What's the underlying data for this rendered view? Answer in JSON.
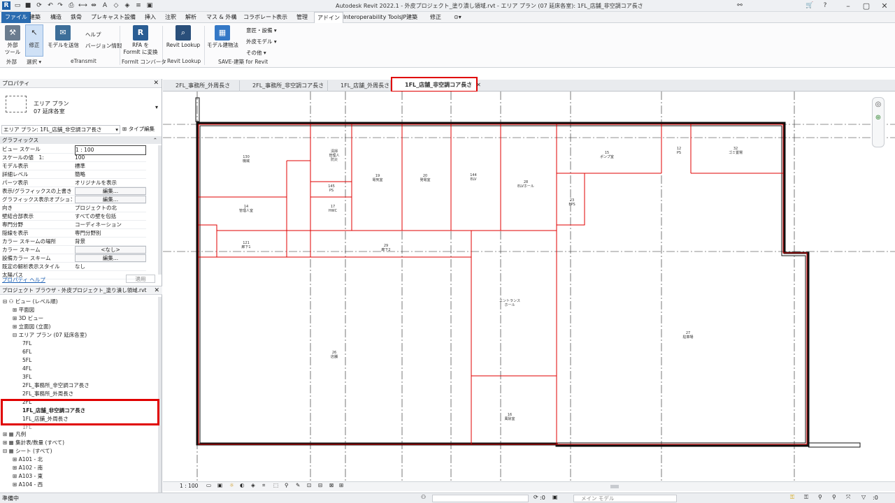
{
  "window": {
    "title": "Autodesk Revit 2022.1 - 外皮プロジェクト_塗り潰し領域.rvt - エリア プラン (07 延床各室): 1FL_店舗_非空調コア長さ"
  },
  "menu": [
    "ファイル",
    "建築",
    "構造",
    "鉄骨",
    "プレキャスト",
    "設備",
    "挿入",
    "注釈",
    "解析",
    "マス & 外構",
    "コラボレート",
    "表示",
    "管理",
    "アドイン",
    "Interoperability Tools",
    "JP建築",
    "修正"
  ],
  "ribbon": {
    "external_tools": "外部\nツール",
    "modify": "修正",
    "send_model": "モデルを送信",
    "help": "ヘルプ",
    "version": "バージョン情報",
    "rfa_formit": "RFA を\nFormIt に変換",
    "revit_lookup": "Revit Lookup",
    "model_property": "モデル建物法",
    "design_equipment": "意匠・設備",
    "skin_model": "外皮モデル",
    "others": "その他",
    "panels": {
      "external": "外部",
      "select": "選択",
      "etransmit": "eTransmit",
      "formit": "FormIt コンバータ",
      "lookup": "Revit Lookup",
      "save": "SAVE-建築 for Revit"
    }
  },
  "properties": {
    "header": "プロパティ",
    "type_name": "エリア プラン",
    "type_sub": "07 延床各室",
    "selector": "エリア プラン: 1FL_店舗_非空調コア長さ",
    "edit_type": "タイプ編集",
    "group": "グラフィックス",
    "rows": [
      {
        "k": "ビュー スケール",
        "v": "1 : 100"
      },
      {
        "k": "スケールの値　1:",
        "v": "100"
      },
      {
        "k": "モデル表示",
        "v": "標準"
      },
      {
        "k": "詳細レベル",
        "v": "簡略"
      },
      {
        "k": "パーツ表示",
        "v": "オリジナルを表示"
      },
      {
        "k": "表示/グラフィックスの上書き",
        "v": "編集..."
      },
      {
        "k": "グラフィックス表示オプション",
        "v": "編集..."
      },
      {
        "k": "向き",
        "v": "プロジェクトの北"
      },
      {
        "k": "壁結合部表示",
        "v": "すべての壁を包括"
      },
      {
        "k": "専門分野",
        "v": "コーディネーション"
      },
      {
        "k": "隠線を表示",
        "v": "専門分野別"
      },
      {
        "k": "カラー スキームの場所",
        "v": "背景"
      },
      {
        "k": "カラー スキーム",
        "v": "<なし>"
      },
      {
        "k": "設備カラー スキーム",
        "v": "編集..."
      },
      {
        "k": "既定の解析表示スタイル",
        "v": "なし"
      },
      {
        "k": "太陽パス",
        "v": ""
      }
    ],
    "help_link": "プロパティ ヘルプ",
    "apply": "適用"
  },
  "browser": {
    "header": "プロジェクト ブラウザ - 外皮プロジェクト_塗り潰し領域.rvt",
    "items": [
      "ビュー (レベル順)",
      "平面図",
      "3D ビュー",
      "立面図 (立面)",
      "エリア プラン (07 延床各室)",
      "7FL",
      "6FL",
      "5FL",
      "4FL",
      "3FL",
      "2FL_事務所_非空調コア長さ",
      "2FL_事務所_外周長さ",
      "2FL",
      "1FL_店舗_非空調コア長さ",
      "1FL_店舗_外周長さ",
      "1FL",
      "凡例",
      "集計表/数量 (すべて)",
      "シート (すべて)",
      "A101 - 北",
      "A102 - 南",
      "A103 - 東",
      "A104 - 西"
    ]
  },
  "tabs": [
    "2FL_事務所_外周長さ",
    "2FL_事務所_非空調コア長さ",
    "1FL_店舗_外周長さ",
    "1FL_店舗_非空調コア長さ"
  ],
  "rooms": [
    {
      "n": "130",
      "name": "機械"
    },
    {
      "n": "",
      "name": "清掃\n管理人\n防災"
    },
    {
      "n": "19",
      "name": "電気室"
    },
    {
      "n": "20",
      "name": "発電室"
    },
    {
      "n": "144",
      "name": "ELV"
    },
    {
      "n": "28",
      "name": "ELVホール"
    },
    {
      "n": "15",
      "name": "ポンプ室"
    },
    {
      "n": "12",
      "name": "PS"
    },
    {
      "n": "32",
      "name": "ゴミ置場"
    },
    {
      "n": "145",
      "name": "PS"
    },
    {
      "n": "14",
      "name": "管理人室"
    },
    {
      "n": "17",
      "name": "HWC"
    },
    {
      "n": "23",
      "name": "EPS"
    },
    {
      "n": "121",
      "name": "廊下1"
    },
    {
      "n": "29",
      "name": "廊下2"
    },
    {
      "n": "",
      "name": "エントランス\nホール"
    },
    {
      "n": "26",
      "name": "店舗"
    },
    {
      "n": "27",
      "name": "駐車場"
    },
    {
      "n": "16",
      "name": "風除室"
    }
  ],
  "viewbar": {
    "scale": "1 : 100"
  },
  "status": {
    "left": "準備中",
    "zero": ":0",
    "model": "メイン モデル"
  }
}
